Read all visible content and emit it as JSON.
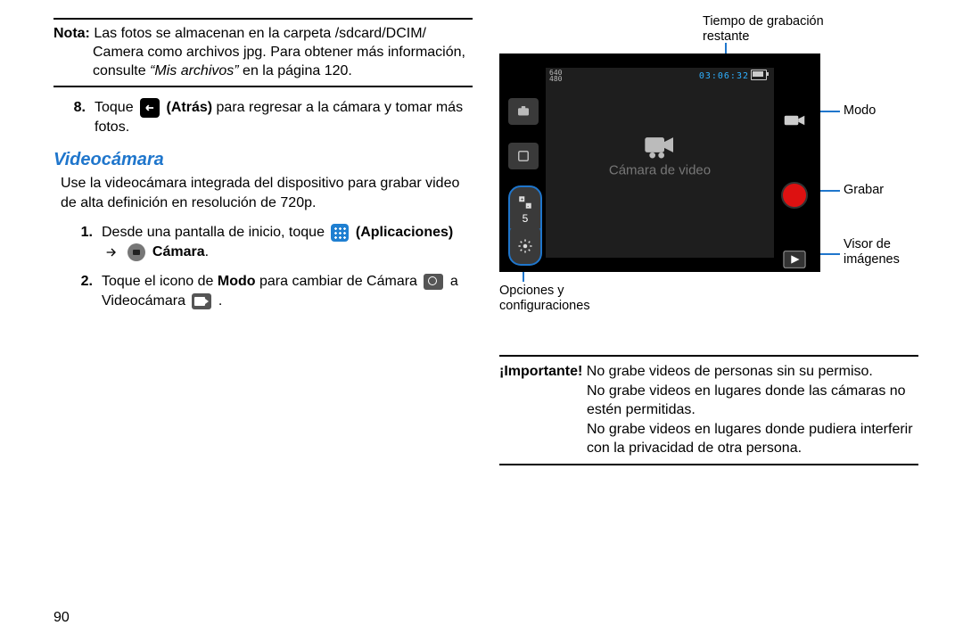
{
  "left": {
    "note_label": "Nota:",
    "note_line1": " Las fotos se almacenan en la carpeta /sdcard/DCIM/",
    "note_line2": "Camera como archivos jpg. Para obtener más información, consulte ",
    "note_italic": "“Mis archivos”",
    "note_line3": " en la página 120.",
    "step8_num": "8.",
    "step8_a": "Toque ",
    "step8_b_bold": "(Atrás)",
    "step8_c": " para regresar a la cámara y tomar más",
    "step8_d": "fotos.",
    "section_title": "Videocámara",
    "intro": "Use la videocámara integrada del dispositivo para grabar video de alta definición en resolución de 720p.",
    "s1_num": "1.",
    "s1_a": "Desde una pantalla de inicio, toque ",
    "s1_apps_bold": "(Aplicaciones)",
    "s1_arrow": "",
    "s1_cam_bold": "Cámara",
    "s1_period": ".",
    "s2_num": "2.",
    "s2_a": "Toque el icono de ",
    "s2_modo_bold": "Modo",
    "s2_b": " para cambiar de Cámara ",
    "s2_c": " a",
    "s2_d": "Videocámara ",
    "s2_e": "."
  },
  "figure": {
    "time_label": "Tiempo de grabación restante",
    "modo_label": "Modo",
    "grabar_label": "Grabar",
    "visor_label": "Visor de imágenes",
    "opts_label": "Opciones y configuraciones",
    "center_caption": "Cámara de video",
    "res_line1": "640",
    "res_line2": "480",
    "timer": "03:06:32",
    "exposure_value": "5"
  },
  "important": {
    "label": "¡Importante!",
    "line1": " No grabe videos de personas sin su permiso.",
    "line2": "No grabe videos en lugares donde las cámaras no estén permitidas.",
    "line3": "No grabe videos en lugares donde pudiera interferir con la privacidad de otra persona."
  },
  "page_number": "90"
}
